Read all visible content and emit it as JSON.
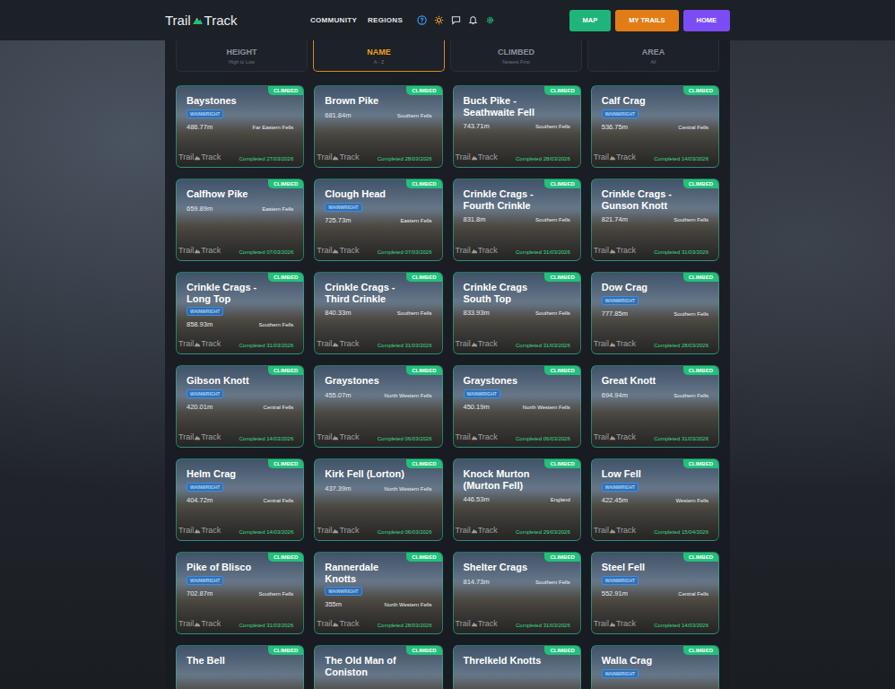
{
  "logo": {
    "left": "Trail",
    "right": "Track"
  },
  "nav": [
    "COMMUNITY",
    "REGIONS"
  ],
  "buttons": [
    {
      "label": "MAP",
      "color": "#1fb57a"
    },
    {
      "label": "MY TRAILS",
      "color": "#e27d16"
    },
    {
      "label": "HOME",
      "color": "#7b4cf5"
    }
  ],
  "sort_tabs": [
    {
      "label": "HEIGHT",
      "sub": "High to Low",
      "selected": false
    },
    {
      "label": "NAME",
      "sub": "A - Z",
      "selected": true
    },
    {
      "label": "CLIMBED",
      "sub": "Newest First",
      "selected": false
    },
    {
      "label": "AREA",
      "sub": "All",
      "selected": false
    }
  ],
  "watermark": {
    "left": "Trail",
    "right": "Track"
  },
  "fells": [
    {
      "name": "Baystones",
      "status": "CLIMBED",
      "tag": "WAINWRIGHT",
      "height": "486.77m",
      "area": "Far Eastern Fells",
      "completed": "Completed 27/03/2026"
    },
    {
      "name": "Brown Pike",
      "status": "CLIMBED",
      "height": "681.84m",
      "area": "Southern Fells",
      "completed": "Completed 28/03/2026"
    },
    {
      "name": "Buck Pike - Seathwaite Fell",
      "status": "CLIMBED",
      "height": "743.71m",
      "area": "Southern Fells",
      "completed": "Completed 28/03/2026"
    },
    {
      "name": "Calf Crag",
      "status": "CLIMBED",
      "tag": "WAINWRIGHT",
      "height": "536.75m",
      "area": "Central Fells",
      "completed": "Completed 14/03/2026"
    },
    {
      "name": "Calfhow Pike",
      "status": "CLIMBED",
      "height": "659.89m",
      "area": "Eastern Fells",
      "completed": "Completed 07/03/2026"
    },
    {
      "name": "Clough Head",
      "status": "CLIMBED",
      "tag": "WAINWRIGHT",
      "height": "725.73m",
      "area": "Eastern Fells",
      "completed": "Completed 07/03/2026"
    },
    {
      "name": "Crinkle Crags - Fourth Crinkle",
      "status": "CLIMBED",
      "height": "831.8m",
      "area": "Southern Fells",
      "completed": "Completed 31/03/2026"
    },
    {
      "name": "Crinkle Crags - Gunson Knott",
      "status": "CLIMBED",
      "height": "821.74m",
      "area": "Southern Fells",
      "completed": "Completed 31/03/2026"
    },
    {
      "name": "Crinkle Crags - Long Top",
      "status": "CLIMBED",
      "tag": "WAINWRIGHT",
      "height": "858.93m",
      "area": "Southern Fells",
      "completed": "Completed 31/03/2026"
    },
    {
      "name": "Crinkle Crags - Third Crinkle",
      "status": "CLIMBED",
      "height": "840.33m",
      "area": "Southern Fells",
      "completed": "Completed 31/03/2026"
    },
    {
      "name": "Crinkle Crags South Top",
      "status": "CLIMBED",
      "height": "833.93m",
      "area": "Southern Fells",
      "completed": "Completed 31/03/2026"
    },
    {
      "name": "Dow Crag",
      "status": "CLIMBED",
      "tag": "WAINWRIGHT",
      "height": "777.85m",
      "area": "Southern Fells",
      "completed": "Completed 28/03/2026"
    },
    {
      "name": "Gibson Knott",
      "status": "CLIMBED",
      "tag": "WAINWRIGHT",
      "height": "420.01m",
      "area": "Central Fells",
      "completed": "Completed 14/03/2026"
    },
    {
      "name": "Graystones",
      "status": "CLIMBED",
      "height": "455.07m",
      "area": "North Western Fells",
      "completed": "Completed 06/03/2026"
    },
    {
      "name": "Graystones",
      "status": "CLIMBED",
      "tag": "WAINWRIGHT",
      "height": "450.19m",
      "area": "North Western Fells",
      "completed": "Completed 06/03/2026"
    },
    {
      "name": "Great Knott",
      "status": "CLIMBED",
      "height": "694.94m",
      "area": "Southern Fells",
      "completed": "Completed 31/03/2026"
    },
    {
      "name": "Helm Crag",
      "status": "CLIMBED",
      "tag": "WAINWRIGHT",
      "height": "404.72m",
      "area": "Central Fells",
      "completed": "Completed 14/03/2026"
    },
    {
      "name": "Kirk Fell (Lorton)",
      "status": "CLIMBED",
      "height": "437.39m",
      "area": "North Western Fells",
      "completed": "Completed 06/03/2026"
    },
    {
      "name": "Knock Murton (Murton Fell)",
      "status": "CLIMBED",
      "height": "446.53m",
      "area": "England",
      "completed": "Completed 29/03/2026"
    },
    {
      "name": "Low Fell",
      "status": "CLIMBED",
      "tag": "WAINWRIGHT",
      "height": "422.45m",
      "area": "Western Fells",
      "completed": "Completed 15/04/2026"
    },
    {
      "name": "Pike of Blisco",
      "status": "CLIMBED",
      "tag": "WAINWRIGHT",
      "height": "702.87m",
      "area": "Southern Fells",
      "completed": "Completed 31/03/2026"
    },
    {
      "name": "Rannerdale Knotts",
      "status": "CLIMBED",
      "tag": "WAINWRIGHT",
      "height": "355m",
      "area": "North Western Fells",
      "completed": "Completed 28/03/2026"
    },
    {
      "name": "Shelter Crags",
      "status": "CLIMBED",
      "height": "814.73m",
      "area": "Southern Fells",
      "completed": "Completed 31/03/2026"
    },
    {
      "name": "Steel Fell",
      "status": "CLIMBED",
      "tag": "WAINWRIGHT",
      "height": "552.91m",
      "area": "Central Fells",
      "completed": "Completed 14/03/2026"
    },
    {
      "name": "The Bell",
      "status": "CLIMBED"
    },
    {
      "name": "The Old Man of Coniston",
      "status": "CLIMBED"
    },
    {
      "name": "Threlkeld Knotts",
      "status": "CLIMBED"
    },
    {
      "name": "Walla Crag",
      "status": "CLIMBED",
      "tag": "WAINWRIGHT"
    }
  ]
}
